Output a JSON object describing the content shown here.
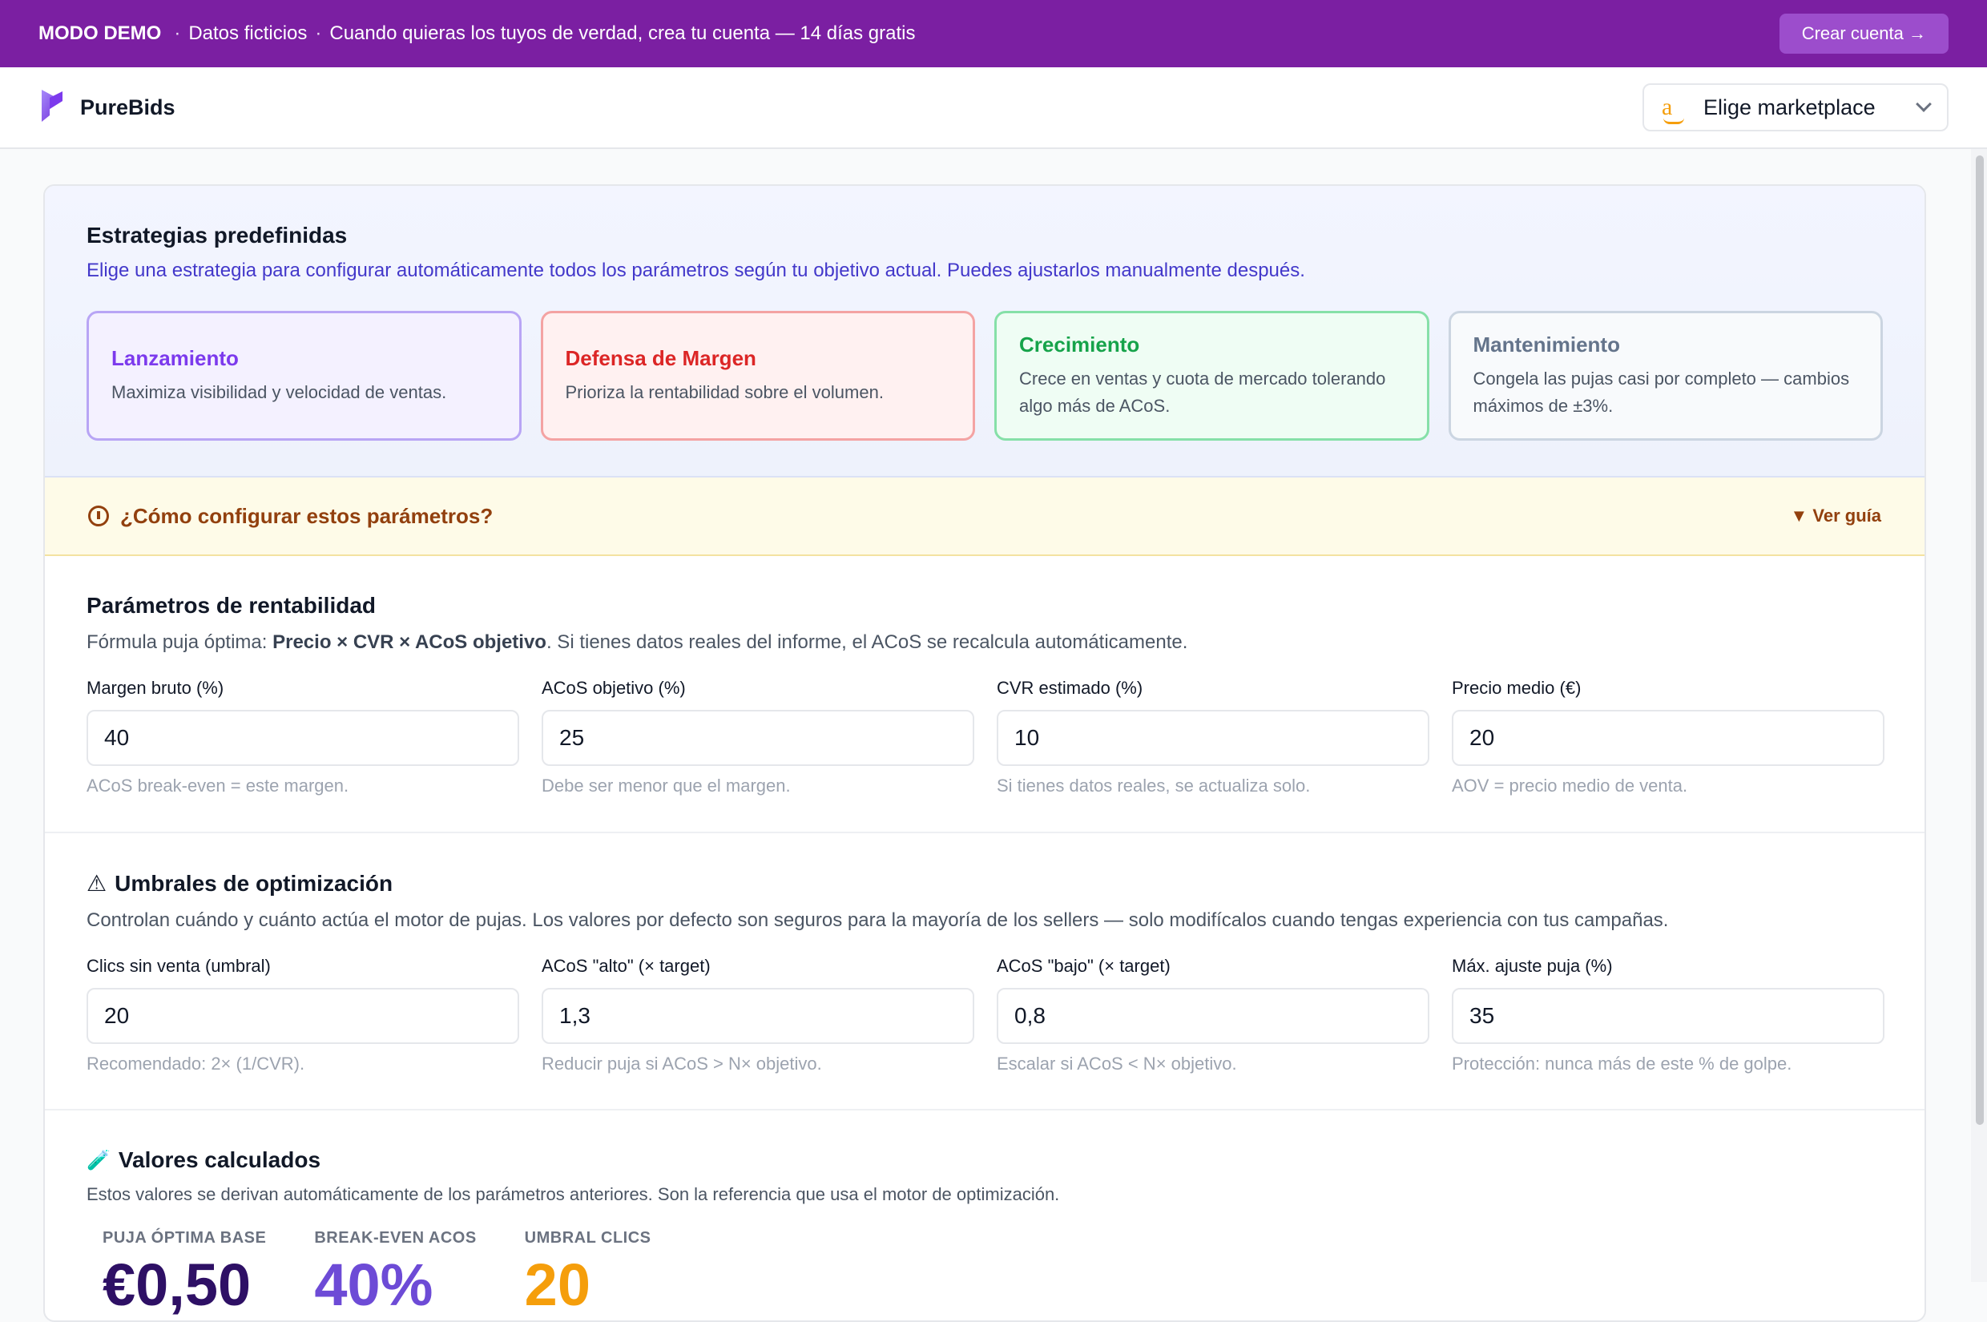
{
  "banner": {
    "mode": "MODO DEMO",
    "sep1": "·",
    "fake_data": "Datos ficticios",
    "sep2": "·",
    "message": "Cuando quieras los tuyos de verdad, crea tu cuenta — 14 días gratis",
    "cta": "Crear cuenta →"
  },
  "header": {
    "brand": "PureBids",
    "marketplace_logo": "a",
    "marketplace_label": "Elige marketplace"
  },
  "strategies": {
    "title": "Estrategias predefinidas",
    "description": "Elige una estrategia para configurar automáticamente todos los parámetros según tu objetivo actual. Puedes ajustarlos manualmente después.",
    "items": [
      {
        "name": "Lanzamiento",
        "desc": "Maximiza visibilidad y velocidad de ventas."
      },
      {
        "name": "Defensa de Margen",
        "desc": "Prioriza la rentabilidad sobre el volumen."
      },
      {
        "name": "Crecimiento",
        "desc": "Crece en ventas y cuota de mercado tolerando algo más de ACoS."
      },
      {
        "name": "Mantenimiento",
        "desc": "Congela las pujas casi por completo — cambios máximos de ±3%."
      }
    ]
  },
  "guide": {
    "question": "¿Cómo configurar estos parámetros?",
    "link": "▼ Ver guía"
  },
  "profitability": {
    "title": "Parámetros de rentabilidad",
    "sub_prefix": "Fórmula puja óptima: ",
    "sub_formula": "Precio × CVR × ACoS objetivo",
    "sub_suffix": ". Si tienes datos reales del informe, el ACoS se recalcula automáticamente.",
    "fields": [
      {
        "label": "Margen bruto (%)",
        "value": "40",
        "hint": "ACoS break-even = este margen."
      },
      {
        "label": "ACoS objetivo (%)",
        "value": "25",
        "hint": "Debe ser menor que el margen."
      },
      {
        "label": "CVR estimado (%)",
        "value": "10",
        "hint": "Si tienes datos reales, se actualiza solo."
      },
      {
        "label": "Precio medio (€)",
        "value": "20",
        "hint": "AOV = precio medio de venta."
      }
    ]
  },
  "thresholds": {
    "icon": "⚠",
    "title": "Umbrales de optimización",
    "sub": "Controlan cuándo y cuánto actúa el motor de pujas. Los valores por defecto son seguros para la mayoría de los sellers — solo modifícalos cuando tengas experiencia con tus campañas.",
    "fields": [
      {
        "label": "Clics sin venta (umbral)",
        "value": "20",
        "hint": "Recomendado: 2× (1/CVR)."
      },
      {
        "label": "ACoS \"alto\" (× target)",
        "value": "1,3",
        "hint": "Reducir puja si ACoS > N× objetivo."
      },
      {
        "label": "ACoS \"bajo\" (× target)",
        "value": "0,8",
        "hint": "Escalar si ACoS < N× objetivo."
      },
      {
        "label": "Máx. ajuste puja (%)",
        "value": "35",
        "hint": "Protección: nunca más de este % de golpe."
      }
    ]
  },
  "calculated": {
    "icon": "🧪",
    "title": "Valores calculados",
    "sub": "Estos valores se derivan automáticamente de los parámetros anteriores. Son la referencia que usa el motor de optimización.",
    "metrics": [
      {
        "label": "PUJA ÓPTIMA BASE",
        "value": "€0,50"
      },
      {
        "label": "BREAK-EVEN ACOS",
        "value": "40%"
      },
      {
        "label": "UMBRAL CLICS",
        "value": "20"
      }
    ]
  },
  "colors": {
    "banner": "#7b1fa2",
    "brand_accent": "#7c3aed",
    "warning_bg": "#fefbe8"
  }
}
